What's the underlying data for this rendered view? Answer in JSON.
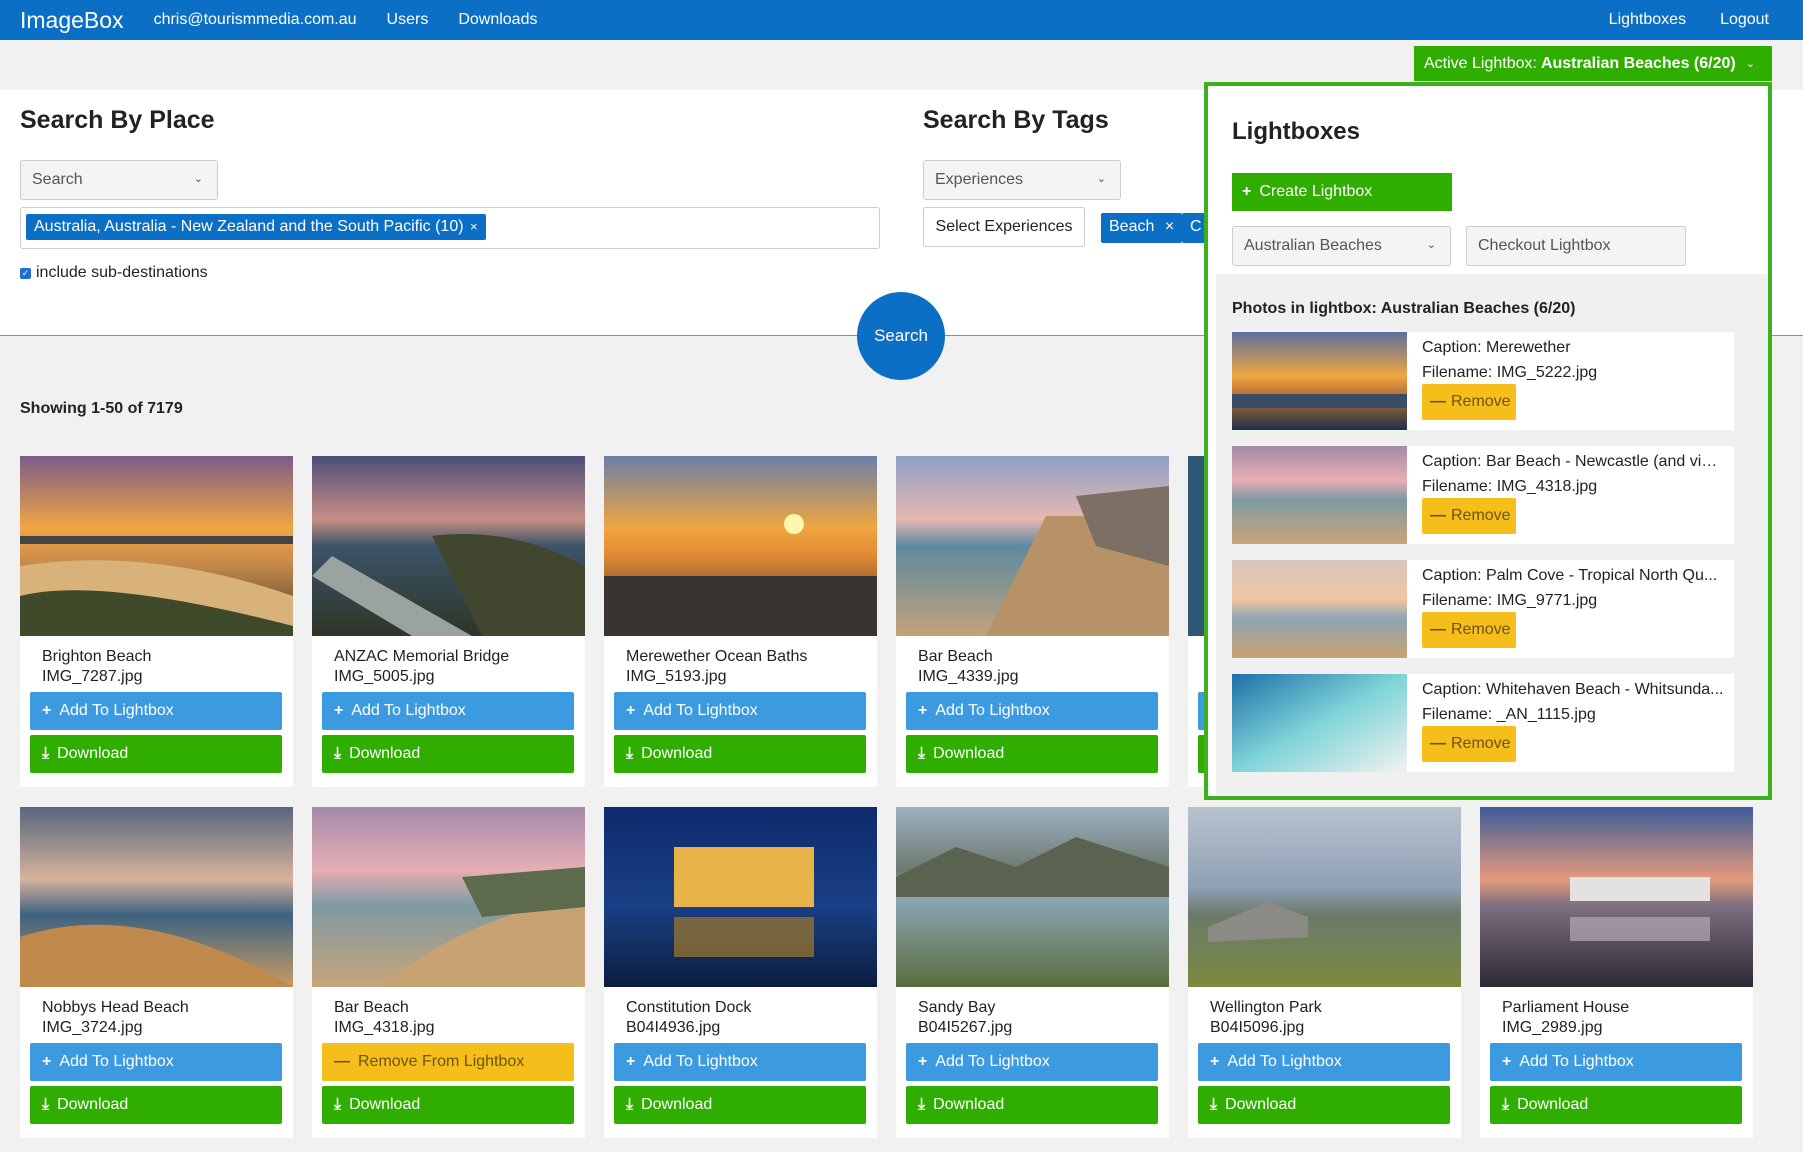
{
  "nav": {
    "brand": "ImageBox",
    "user_email": "chris@tourismmedia.com.au",
    "users": "Users",
    "downloads": "Downloads",
    "lightboxes": "Lightboxes",
    "logout": "Logout"
  },
  "active_lightbox": {
    "label": "Active Lightbox:",
    "name": "Australian Beaches (6/20)"
  },
  "search_place": {
    "heading": "Search By Place",
    "select_value": "Search",
    "tag": "Australia, Australia - New Zealand and the South Pacific (10)",
    "tag_remove": "×",
    "checkbox_label": "include sub-destinations",
    "checkbox_checked": true
  },
  "search_tags": {
    "heading": "Search By Tags",
    "select_value": "Experiences",
    "select_button": "Select Experiences",
    "tags": [
      "Beach",
      "C"
    ],
    "tag_remove": "×"
  },
  "search_button": "Search",
  "results_summary": "Showing 1-50 of 7179",
  "buttons": {
    "add": "Add To Lightbox",
    "remove": "Remove From Lightbox",
    "download": "Download"
  },
  "results": [
    {
      "title": "Brighton Beach",
      "file": "IMG_7287.jpg",
      "in_lightbox": false
    },
    {
      "title": "ANZAC Memorial Bridge",
      "file": "IMG_5005.jpg",
      "in_lightbox": false
    },
    {
      "title": "Merewether Ocean Baths",
      "file": "IMG_5193.jpg",
      "in_lightbox": false
    },
    {
      "title": "Bar Beach",
      "file": "IMG_4339.jpg",
      "in_lightbox": false
    },
    {
      "title": "Nobbys Head Beach",
      "file": "IMG_3724.jpg",
      "in_lightbox": false
    },
    {
      "title": "Bar Beach",
      "file": "IMG_4318.jpg",
      "in_lightbox": true
    },
    {
      "title": "Constitution Dock",
      "file": "B04I4936.jpg",
      "in_lightbox": false
    },
    {
      "title": "Sandy Bay",
      "file": "B04I5267.jpg",
      "in_lightbox": false
    },
    {
      "title": "Wellington Park",
      "file": "B04I5096.jpg",
      "in_lightbox": false
    },
    {
      "title": "Parliament House",
      "file": "IMG_2989.jpg",
      "in_lightbox": false
    }
  ],
  "lightbox_panel": {
    "title": "Lightboxes",
    "create_button": "Create Lightbox",
    "select_value": "Australian Beaches",
    "checkout_placeholder": "Checkout Lightbox",
    "photos_heading": "Photos in lightbox: Australian Beaches (6/20)",
    "remove_label": "Remove",
    "items": [
      {
        "caption": "Caption: Merewether",
        "filename": "Filename: IMG_5222.jpg"
      },
      {
        "caption": "Caption: Bar Beach - Newcastle (and vici...",
        "filename": "Filename: IMG_4318.jpg"
      },
      {
        "caption": "Caption: Palm Cove - Tropical North Qu...",
        "filename": "Filename: IMG_9771.jpg"
      },
      {
        "caption": "Caption: Whitehaven Beach - Whitsunda...",
        "filename": "Filename: _AN_1115.jpg"
      }
    ]
  },
  "colors": {
    "nav_blue": "#0b6fc6",
    "add_blue": "#3c9be0",
    "download_green": "#2fae00",
    "remove_yellow": "#f6be1b",
    "lightbox_border": "#3cb01d"
  }
}
